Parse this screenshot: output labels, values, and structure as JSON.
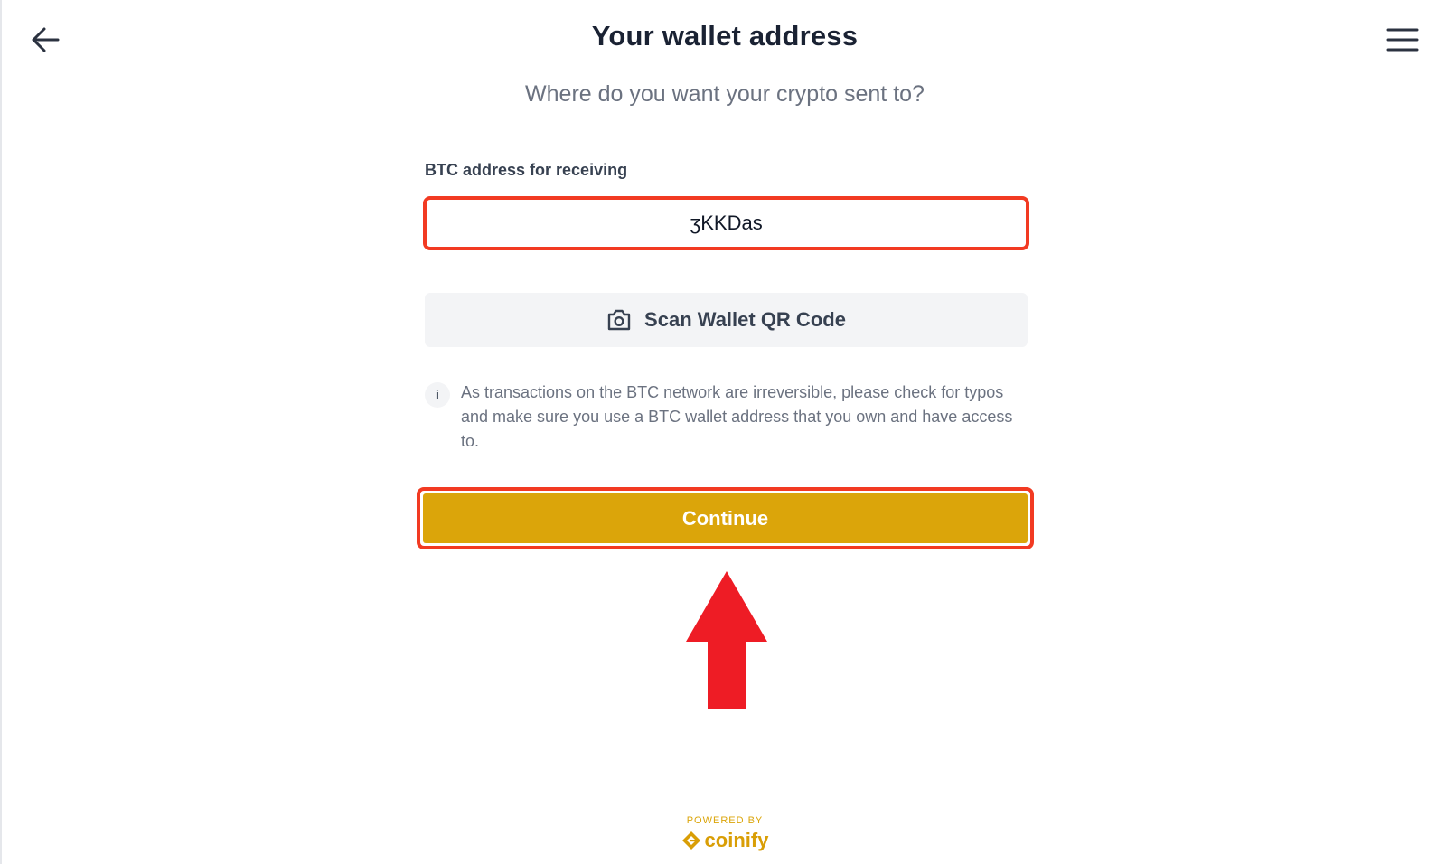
{
  "header": {
    "title": "Your wallet address",
    "subtitle": "Where do you want your crypto sent to?",
    "back_icon": "arrow-left-icon",
    "menu_icon": "hamburger-menu-icon"
  },
  "form": {
    "address_label": "BTC address for receiving",
    "address_value": "ʒKKDas",
    "scan_label": "Scan Wallet QR Code",
    "scan_icon": "camera-icon",
    "info_icon": "info-icon",
    "info_text": "As transactions on the BTC network are irreversible, please check for typos and make sure you use a BTC wallet address that you own and have access to.",
    "continue_label": "Continue"
  },
  "footer": {
    "powered_by": "POWERED BY",
    "brand": "coinify"
  },
  "colors": {
    "accent": "#dba50a",
    "highlight": "#f23a22",
    "arrow": "#ee1c25"
  }
}
